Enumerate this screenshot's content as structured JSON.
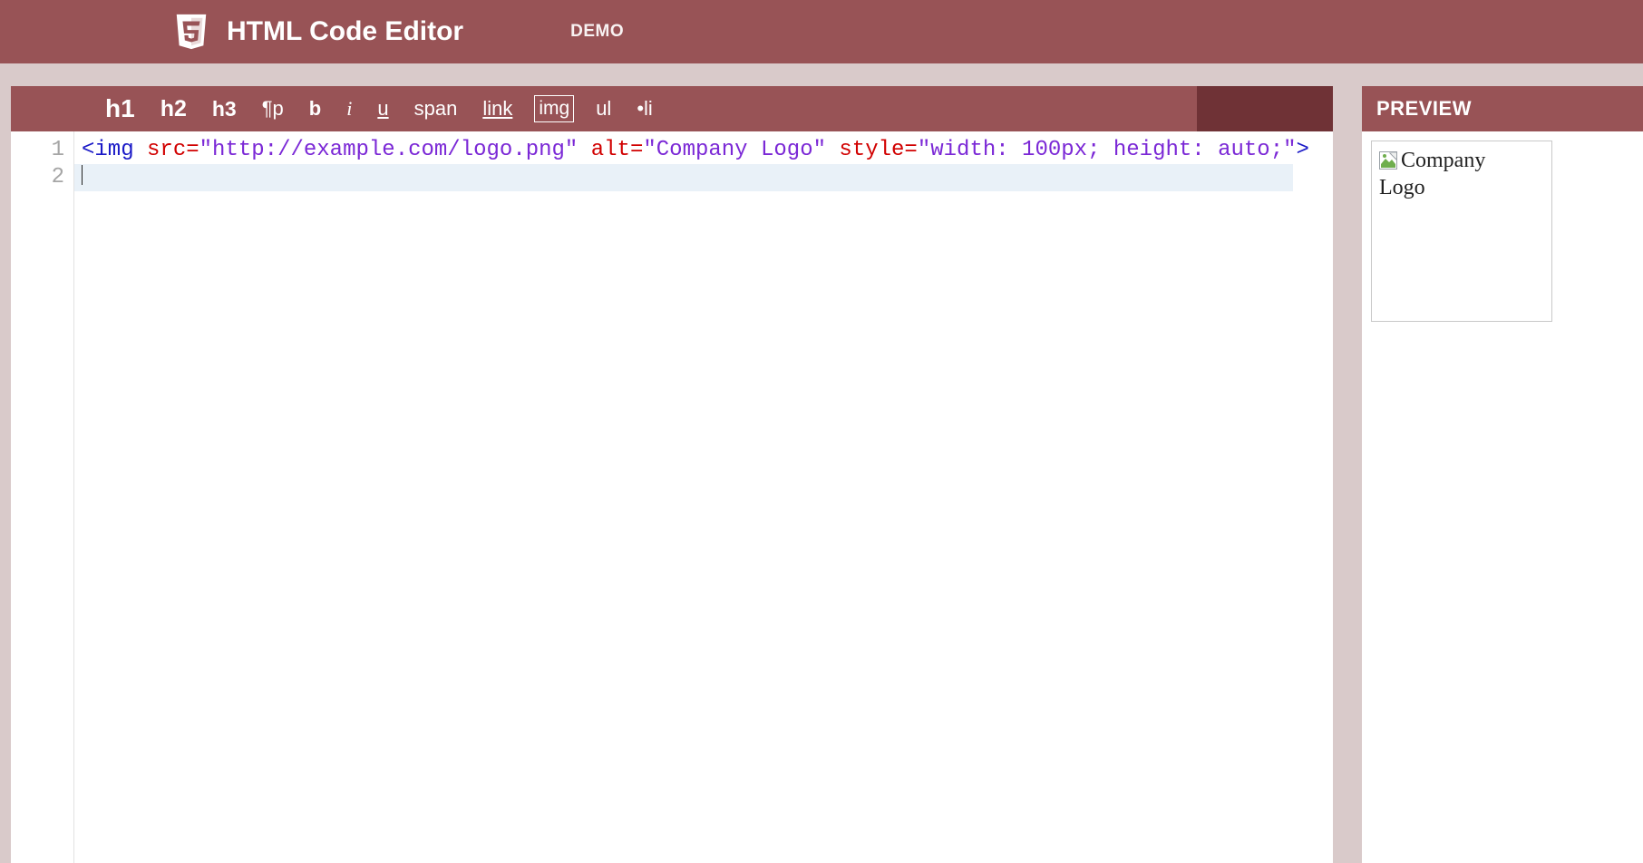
{
  "header": {
    "title": "HTML Code Editor",
    "nav": {
      "demo": "DEMO"
    }
  },
  "toolbar": {
    "h1": "h1",
    "h2": "h2",
    "h3": "h3",
    "p": "¶p",
    "b": "b",
    "i": "i",
    "u": "u",
    "span": "span",
    "link": "link",
    "img": "img",
    "ul": "ul",
    "li": "•li"
  },
  "editor": {
    "gutter": [
      "1",
      "2"
    ],
    "code_line1": {
      "open_angle": "<",
      "tag": "img",
      "sp1": " ",
      "attr_src": "src",
      "eq1": "=",
      "val_src": "\"http://example.com/logo.png\"",
      "sp2": " ",
      "attr_alt": "alt",
      "eq2": "=",
      "val_alt": "\"Company Logo\"",
      "sp3": " ",
      "attr_style": "style",
      "eq3": "=",
      "val_style": "\"width: 100px; height: auto;\"",
      "close_angle": ">"
    }
  },
  "preview": {
    "title": "PREVIEW",
    "alt_text_line1": "Company",
    "alt_text_line2": "Logo"
  }
}
